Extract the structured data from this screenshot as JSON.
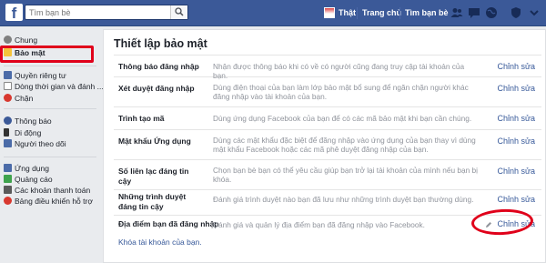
{
  "topbar": {
    "search_placeholder": "Tìm bạn bè",
    "user_name": "Thật",
    "home_label": "Trang chủ",
    "find_friends_label": "Tìm bạn bè"
  },
  "sidebar": {
    "items": [
      {
        "label": "Chung",
        "icon": "gear-icon"
      },
      {
        "label": "Bảo mật",
        "icon": "shield-icon"
      },
      {
        "label": "Quyền riêng tư",
        "icon": "lock-icon"
      },
      {
        "label": "Dòng thời gian và đánh ...",
        "icon": "timeline-icon"
      },
      {
        "label": "Chặn",
        "icon": "block-icon"
      },
      {
        "label": "Thông báo",
        "icon": "globe-icon"
      },
      {
        "label": "Di động",
        "icon": "mobile-icon"
      },
      {
        "label": "Người theo dõi",
        "icon": "followers-icon"
      },
      {
        "label": "Ứng dụng",
        "icon": "apps-icon"
      },
      {
        "label": "Quảng cáo",
        "icon": "ads-icon"
      },
      {
        "label": "Các khoản thanh toán",
        "icon": "payments-icon"
      },
      {
        "label": "Bảng điều khiển hỗ trợ",
        "icon": "support-icon"
      }
    ]
  },
  "main": {
    "title": "Thiết lập bảo mật",
    "rows": [
      {
        "label": "Thông báo đăng nhập",
        "desc": "Nhận được thông báo khi có về có người cũng đang truy cập tài khoản của bạn.",
        "edit": "Chỉnh sửa"
      },
      {
        "label": "Xét duyệt đăng nhập",
        "desc": "Dùng điện thoại của bạn làm lớp bảo mật bổ sung để ngăn chặn người khác đăng nhập vào tài khoản của bạn.",
        "edit": "Chỉnh sửa"
      },
      {
        "label": "Trình tạo mã",
        "desc": "Dùng ứng dụng Facebook của bạn để có các mã bảo mật khi bạn cần chúng.",
        "edit": "Chỉnh sửa"
      },
      {
        "label": "Mật khẩu Ứng dụng",
        "desc": "Dùng các mật khẩu đặc biệt để đăng nhập vào ứng dụng của bạn thay vì dùng mật khẩu Facebook hoặc các mã phê duyệt đăng nhập của bạn.",
        "edit": "Chỉnh sửa"
      },
      {
        "label": "Số liên lạc đáng tin cậy",
        "desc": "Chọn bạn bè bạn có thể yêu cầu giúp bạn trở lại tài khoản của mình nếu bạn bị khóa.",
        "edit": "Chỉnh sửa"
      },
      {
        "label": "Những trình duyệt đáng tin cậy",
        "desc": "Đánh giá trình duyệt nào bạn đã lưu như những trình duyệt bạn thường dùng.",
        "edit": "Chỉnh sửa"
      },
      {
        "label": "Địa điểm bạn đã đăng nhập",
        "desc": "Đánh giá và quản lý địa điểm bạn đã đăng nhập vào Facebook.",
        "edit": "Chỉnh sửa"
      }
    ],
    "deactivate_link": "Khóa tài khoản của bạn."
  },
  "colors": {
    "brand": "#3b5998",
    "link": "#365899",
    "highlight": "#e0001a"
  }
}
